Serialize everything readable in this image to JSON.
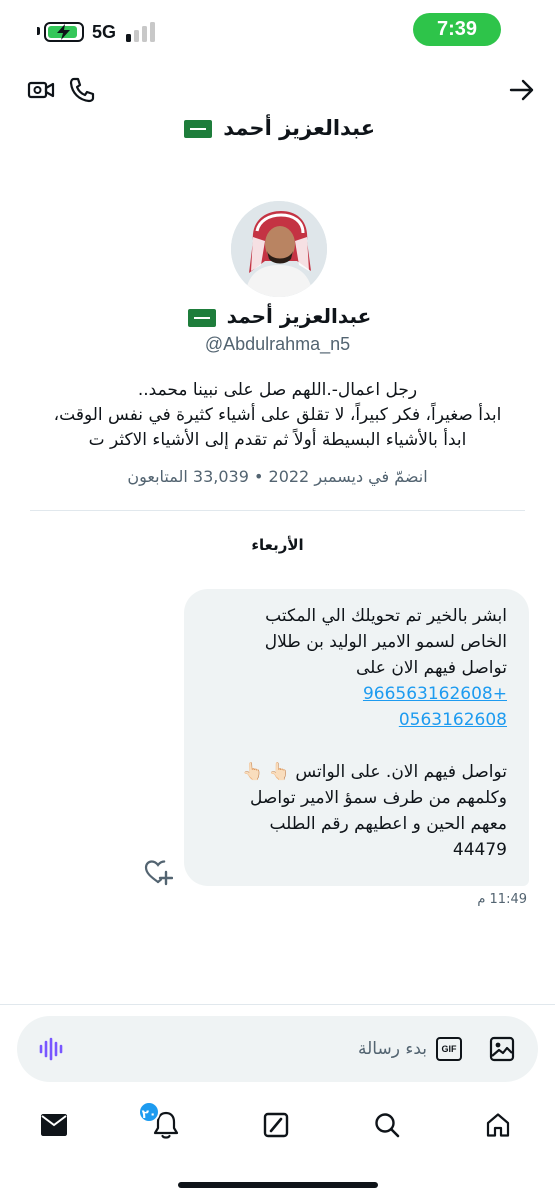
{
  "status_bar": {
    "network": "5G",
    "time": "7:39",
    "battery_level": 0.92
  },
  "header": {
    "title": "عبدالعزيز أحمد"
  },
  "profile": {
    "name": "عبدالعزيز أحمد",
    "handle": "@Abdulrahma_n5",
    "bio_lines": [
      "رجل اعمال-.اللهم صل على نبينا محمد..",
      "ابدأ صغيراً، فكر كبيراً، لا تقلق على أشياء كثيرة في نفس الوقت،",
      "ابدأ بالأشياء البسيطة أولاً ثم تقدم إلى الأشياء الاكثر ت"
    ],
    "joined": "انضمّ في ديسمبر 2022",
    "separator": "•",
    "followers_count": "33,039",
    "followers_label": "المتابعون"
  },
  "conversation": {
    "day_label": "الأربعاء",
    "message": {
      "lines": [
        "ابشر بالخير  تم  تحويلك   الي المكتب",
        "الخاص لسمو الامير الوليد بن طلال",
        "تواصل فيهم الان على"
      ],
      "links": [
        "966563162608+",
        "0563162608"
      ],
      "lines_after": [
        "تواصل فيهم الان. على الواتس  👆🏻 👆🏻",
        "وكلمهم من طرف سمؤ الامير  تواصل",
        "معهم الحين و  اعطيهم رقم الطلب",
        "44479"
      ],
      "time": "11:49 م"
    }
  },
  "composer": {
    "placeholder": "بدء رسالة",
    "gif_label": "GIF"
  },
  "tabs": {
    "notifications_badge": "٢٠"
  },
  "colors": {
    "accent": "#1d9bf0",
    "status_green": "#2ec44a",
    "bubble_bg": "#eff3f4",
    "voice_purple": "#7856ff"
  }
}
